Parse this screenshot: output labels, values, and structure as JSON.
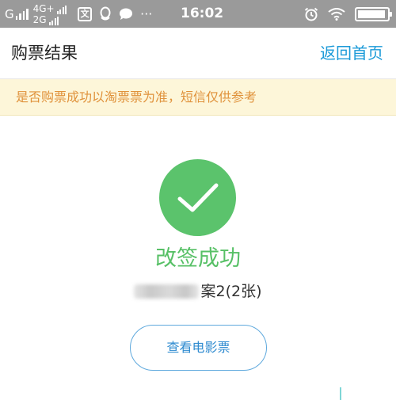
{
  "status_bar": {
    "carrier_g": "G",
    "network_top": "4G+",
    "network_bottom": "2G",
    "app_icon_text": "文",
    "more": "···",
    "time": "16:02",
    "battery_level": 0.95
  },
  "header": {
    "title": "购票结果",
    "home_link": "返回首页"
  },
  "notice": {
    "text": "是否购票成功以淘票票为准，短信仅供参考"
  },
  "result": {
    "title": "改签成功",
    "detail_suffix": "案2(2张)",
    "view_button": "查看电影票"
  },
  "colors": {
    "success_green": "#5bc36c",
    "link_blue": "#1b9ad8",
    "notice_bg": "#fdf6d9",
    "notice_text": "#e0923b"
  }
}
